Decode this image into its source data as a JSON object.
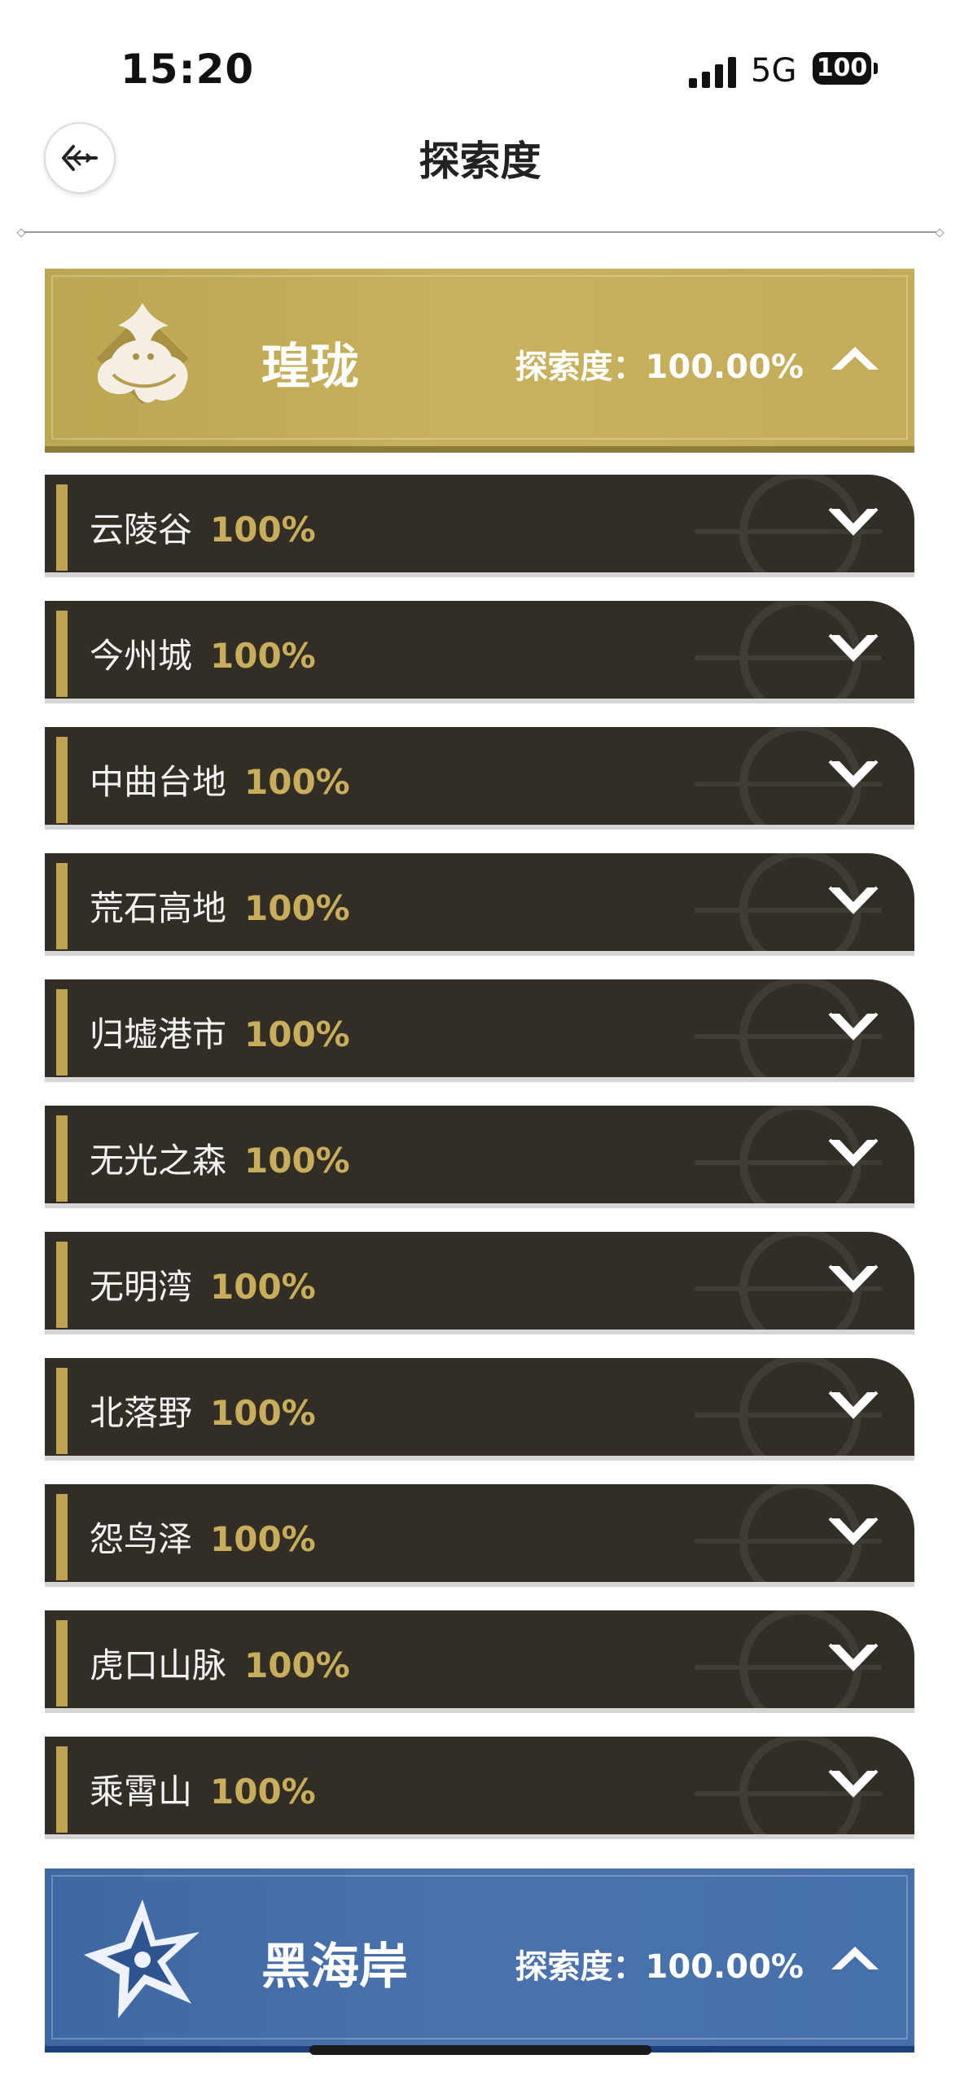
{
  "status_bar": {
    "time": "15:20",
    "network": "5G",
    "battery": "100"
  },
  "nav": {
    "title": "探索度",
    "back_icon": "back-arrow-icon"
  },
  "regions": [
    {
      "name": "瑝珑",
      "progress": "探索度：100.00%",
      "color": "#c3ac5a",
      "emblem_icon": "dragon-emblem-icon"
    },
    {
      "name": "黑海岸",
      "progress": "探索度：100.00%",
      "color": "#4670ab",
      "emblem_icon": "star-emblem-icon"
    }
  ],
  "areas": [
    {
      "name": "云陵谷",
      "pct": "100%"
    },
    {
      "name": "今州城",
      "pct": "100%"
    },
    {
      "name": "中曲台地",
      "pct": "100%"
    },
    {
      "name": "荒石高地",
      "pct": "100%"
    },
    {
      "name": "归墟港市",
      "pct": "100%"
    },
    {
      "name": "无光之森",
      "pct": "100%"
    },
    {
      "name": "无明湾",
      "pct": "100%"
    },
    {
      "name": "北落野",
      "pct": "100%"
    },
    {
      "name": "怨鸟泽",
      "pct": "100%"
    },
    {
      "name": "虎口山脉",
      "pct": "100%"
    },
    {
      "name": "乘霄山",
      "pct": "100%"
    }
  ],
  "colors": {
    "row_bg": "#322e25",
    "accent_gold": "#c7ad5c"
  }
}
